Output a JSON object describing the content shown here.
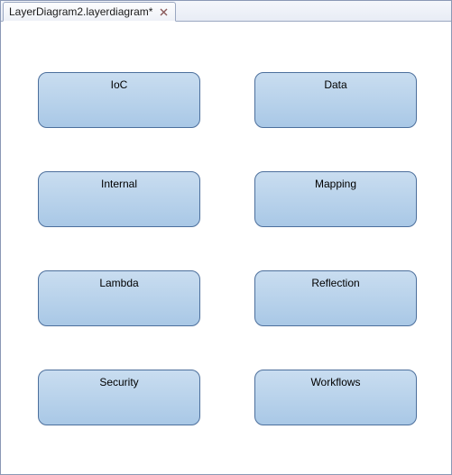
{
  "tab": {
    "label": "LayerDiagram2.layerdiagram*"
  },
  "nodes": {
    "n0": "IoC",
    "n1": "Data",
    "n2": "Internal",
    "n3": "Mapping",
    "n4": "Lambda",
    "n5": "Reflection",
    "n6": "Security",
    "n7": "Workflows"
  }
}
